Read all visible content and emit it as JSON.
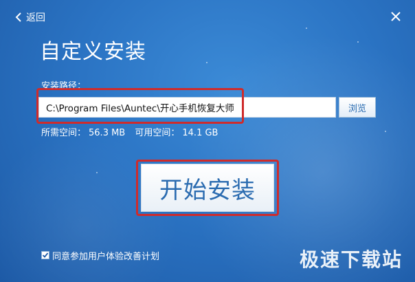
{
  "header": {
    "back_label": "返回",
    "title": "自定义安装"
  },
  "install_path": {
    "label": "安装路径：",
    "value": "C:\\Program Files\\Auntec\\开心手机恢复大师",
    "browse_label": "浏览"
  },
  "space": {
    "required_label": "所需空间：",
    "required_value": "56.3 MB",
    "available_label": "可用空间：",
    "available_value": "14.1 GB"
  },
  "install_button_label": "开始安装",
  "agreement": {
    "checked": true,
    "label": "同意参加用户体验改善计划"
  },
  "watermark": "极速下载站",
  "colors": {
    "accent": "#2a6bb0",
    "highlight": "#cf2b2b",
    "background": "#2b74c4"
  },
  "icons": {
    "back": "chevron-left-icon",
    "close": "close-icon",
    "check": "checkmark-icon"
  }
}
